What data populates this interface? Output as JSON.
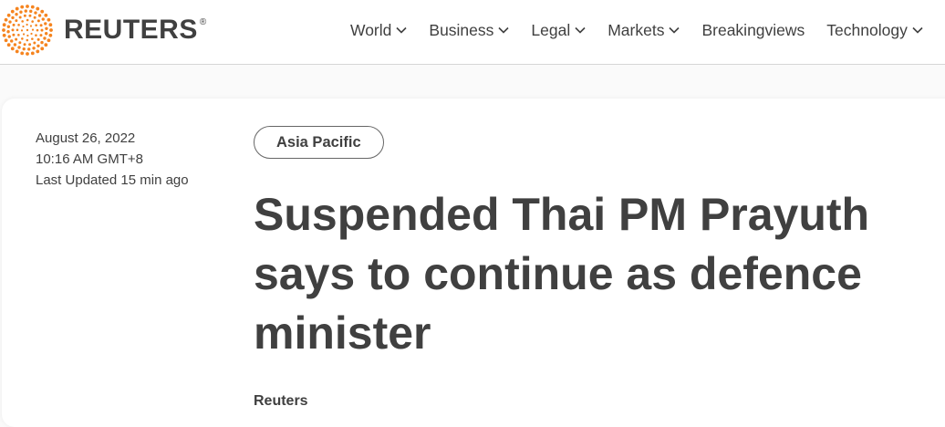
{
  "header": {
    "brand": "REUTERS",
    "registered_mark": "®",
    "brand_color": "#f5841f",
    "nav": [
      {
        "label": "World",
        "dropdown": true
      },
      {
        "label": "Business",
        "dropdown": true
      },
      {
        "label": "Legal",
        "dropdown": true
      },
      {
        "label": "Markets",
        "dropdown": true
      },
      {
        "label": "Breakingviews",
        "dropdown": false
      },
      {
        "label": "Technology",
        "dropdown": true
      }
    ]
  },
  "article": {
    "date": "August 26, 2022",
    "time": "10:16 AM GMT+8",
    "updated": "Last Updated 15 min ago",
    "section": "Asia Pacific",
    "headline": "Suspended Thai PM Prayuth says to continue as defence minister",
    "byline": "Reuters"
  }
}
